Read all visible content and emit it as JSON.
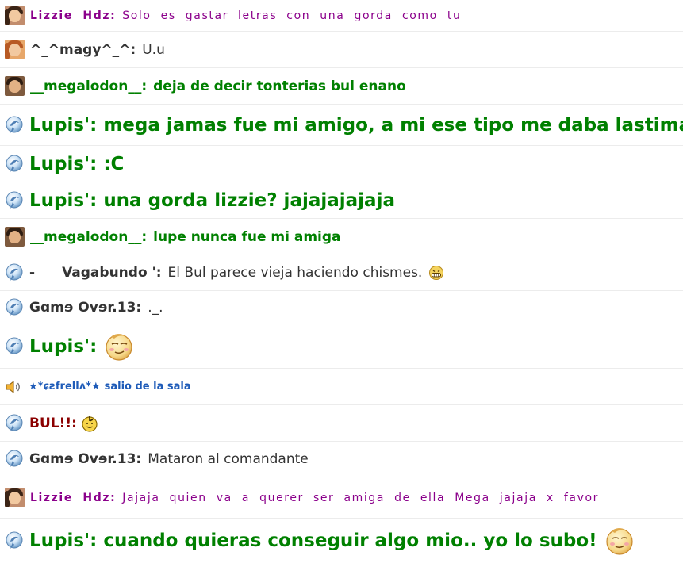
{
  "messages": [
    {
      "sender": "Lizzie Hdz:",
      "text": "Solo es gastar letras con una gorda como tu",
      "avatar": "lizzie-avatar"
    },
    {
      "sender": "^_^magy^_^:",
      "text": "U.u",
      "avatar": "magy-avatar"
    },
    {
      "sender": "__megalodon__:",
      "text": "deja de decir tonterias bul enano",
      "avatar": "megalodon-avatar"
    },
    {
      "sender": "Lupis':",
      "text": "mega jamas fue mi amigo, a mi ese tipo me daba lastima",
      "avatar": "dolphin-icon"
    },
    {
      "sender": "Lupis':",
      "text": ":C",
      "avatar": "dolphin-icon"
    },
    {
      "sender": "Lupis':",
      "text": "una gorda lizzie? jajajajajaja",
      "avatar": "dolphin-icon"
    },
    {
      "sender": "__megalodon__:",
      "text": "lupe nunca fue mi amiga",
      "avatar": "megalodon-avatar"
    },
    {
      "sender_prefix": "-",
      "sender": "Vagabundo ':",
      "text": "El Bul parece vieja haciendo chismes.",
      "avatar": "dolphin-icon",
      "emoticon": "grin-emoticon"
    },
    {
      "sender": "Gɑmɘ Ovɘr.13:",
      "text": "._.",
      "avatar": "dolphin-icon"
    },
    {
      "sender": "Lupis':",
      "text": "",
      "avatar": "dolphin-icon",
      "emoticon": "smug-smiley-emoticon"
    },
    {
      "sender": "★*ɕƨfrellʌ*★",
      "text": "salio de la sala",
      "avatar": "speaker-icon"
    },
    {
      "sender": "BUL!!:",
      "text": "",
      "avatar": "dolphin-icon",
      "emoticon": "thumbs-up-smiley-emoticon"
    },
    {
      "sender": "Gɑmɘ Ovɘr.13:",
      "text": "Mataron al comandante",
      "avatar": "dolphin-icon"
    },
    {
      "sender": "Lizzie Hdz:",
      "text": "Jajaja quien va a querer ser amiga de ella Mega jajaja x favor",
      "avatar": "lizzie-avatar"
    },
    {
      "sender": "Lupis':",
      "text": "cuando quieras conseguir algo mio.. yo lo subo!",
      "avatar": "dolphin-icon",
      "emoticon": "smug-smiley-emoticon"
    }
  ],
  "colors": {
    "purple": "#8b008b",
    "green": "#008000",
    "dark": "#333333",
    "dark_red": "#8b0000",
    "system_blue": "#1e5bb8"
  }
}
